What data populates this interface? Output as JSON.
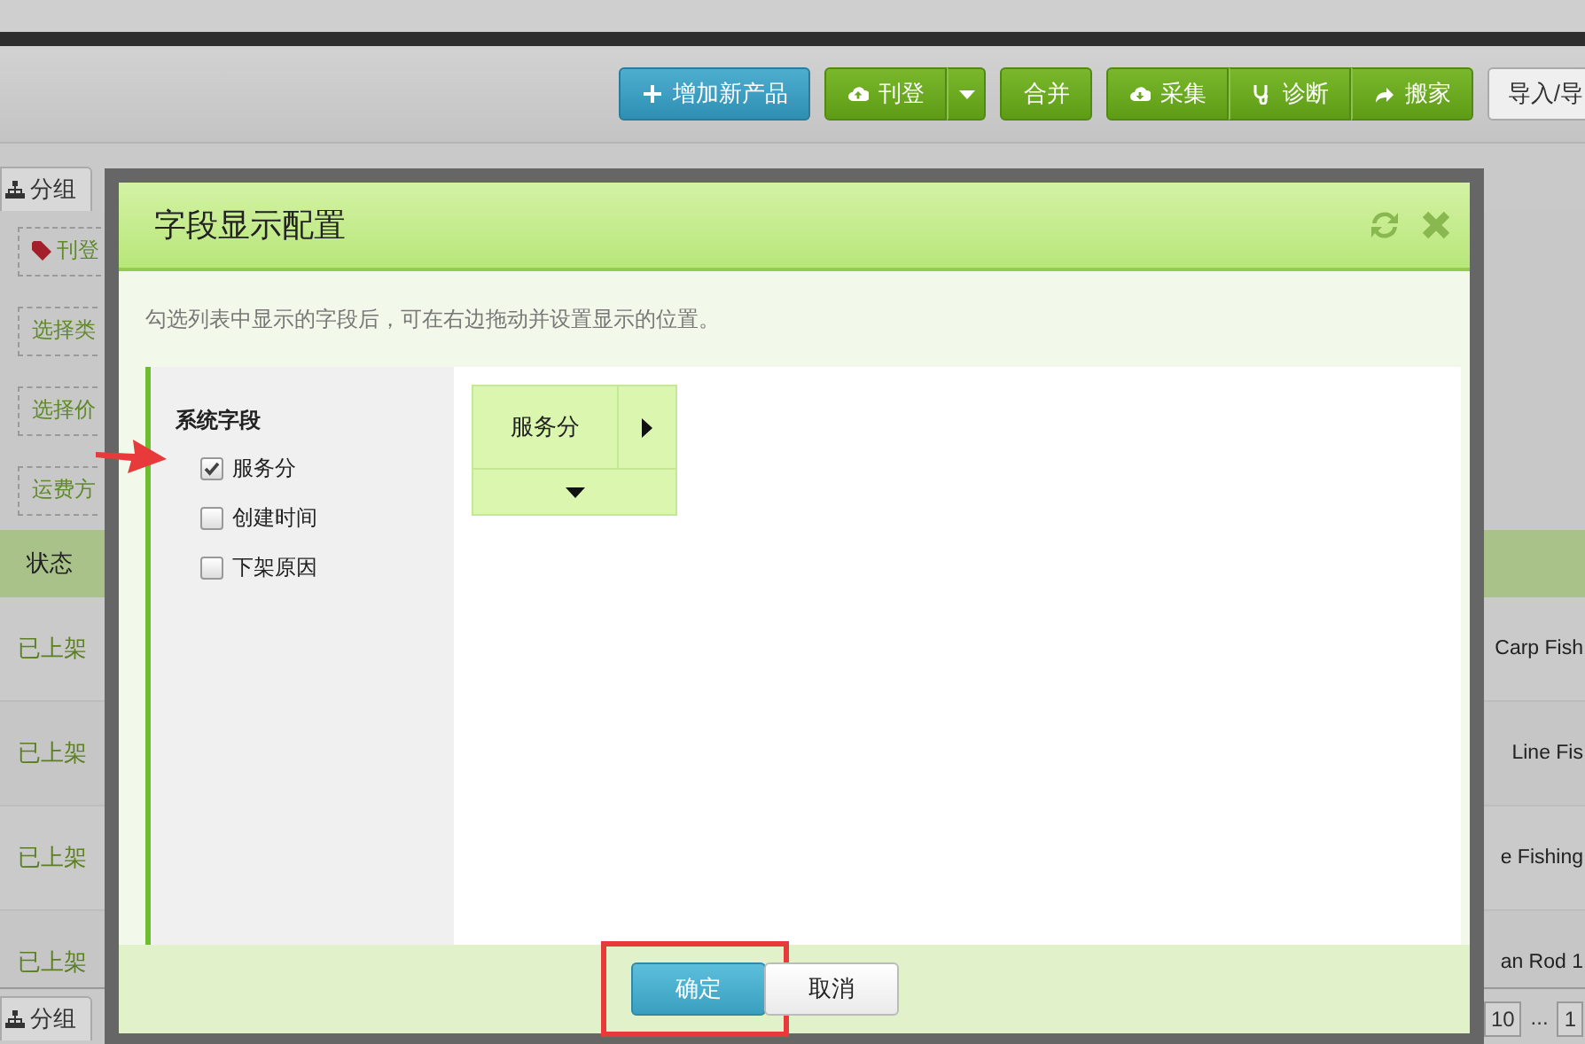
{
  "toolbar": {
    "buttons": [
      {
        "label": "增加新产品",
        "kind": "add"
      },
      {
        "label": "刊登",
        "kind": "publish"
      },
      {
        "label": "合并",
        "kind": "merge"
      },
      {
        "label": "采集",
        "kind": "collect"
      },
      {
        "label": "诊断",
        "kind": "diagnose"
      },
      {
        "label": "搬家",
        "kind": "move"
      },
      {
        "label": "导入/导",
        "kind": "import"
      }
    ]
  },
  "secondary_toolbar": {
    "group_button": "分组"
  },
  "filters": [
    {
      "label": "刊登",
      "kind": "tag"
    },
    {
      "label": "选择类",
      "kind": "select"
    },
    {
      "label": "选择价",
      "kind": "select"
    },
    {
      "label": "运费方",
      "kind": "select"
    }
  ],
  "table": {
    "columns": [
      "状态"
    ],
    "rows": [
      {
        "status": "已上架",
        "column_2": "Carp Fish"
      },
      {
        "status": "已上架",
        "column_2": "Line Fis"
      },
      {
        "status": "已上架",
        "column_2": "e Fishing"
      },
      {
        "status": "已上架",
        "column_2": "an Rod 1"
      }
    ]
  },
  "footer": {
    "group_button": "分组",
    "pages": [
      "10",
      "...",
      "1"
    ]
  },
  "dialog": {
    "title": "字段显示配置",
    "description": "勾选列表中显示的字段后，可在右边拖动并设置显示的位置。",
    "system_fields": {
      "title": "系统字段",
      "fields": [
        {
          "label": "服务分",
          "checked": true
        },
        {
          "label": "创建时间",
          "checked": false
        },
        {
          "label": "下架原因",
          "checked": false
        }
      ]
    },
    "layout_tiles": [
      {
        "label": "服务分"
      }
    ],
    "buttons": [
      {
        "label": "确定",
        "kind": "primary"
      },
      {
        "label": "取消",
        "kind": "secondary"
      }
    ]
  }
}
